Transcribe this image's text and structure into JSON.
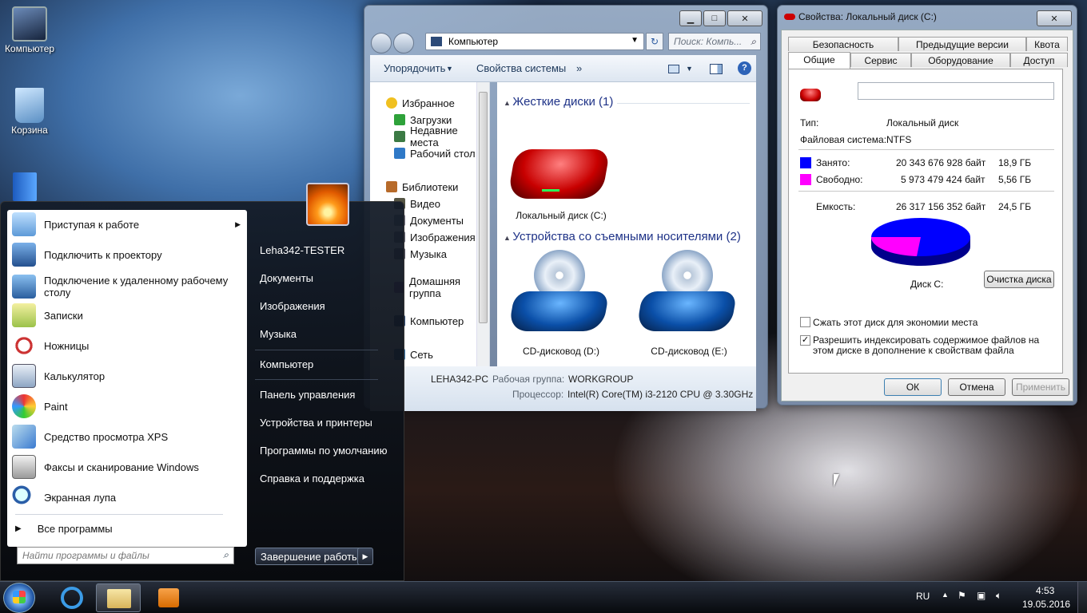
{
  "desktop": {
    "icons": [
      {
        "label": "Компьютер"
      },
      {
        "label": "Корзина"
      }
    ]
  },
  "explorer": {
    "breadcrumb": "Компьютер",
    "search_placeholder": "Поиск: Компь...",
    "toolbar": {
      "organize": "Упорядочить",
      "system_props": "Свойства системы",
      "more": "»"
    },
    "nav": {
      "favorites": "Избранное",
      "downloads": "Загрузки",
      "recent": "Недавние места",
      "desktop": "Рабочий стол",
      "libraries": "Библиотеки",
      "video": "Видео",
      "documents": "Документы",
      "images": "Изображения",
      "music": "Музыка",
      "homegroup": "Домашняя группа",
      "computer": "Компьютер",
      "network": "Сеть"
    },
    "groups": {
      "hdd": "Жесткие диски (1)",
      "removable": "Устройства со съемными носителями (2)"
    },
    "devices": {
      "c": "Локальный диск (C:)",
      "d": "CD-дисковод (D:)",
      "e": "CD-дисковод (E:)"
    },
    "details": {
      "pc_name": "LEHA342-PC",
      "workgroup_label": "Рабочая группа:",
      "workgroup": "WORKGROUP",
      "cpu_label": "Процессор:",
      "cpu": "Intel(R) Core(TM) i3-2120 CPU @ 3.30GHz"
    }
  },
  "start_menu": {
    "items": [
      "Приступая к работе",
      "Подключить к проектору",
      "Подключение к удаленному рабочему столу",
      "Записки",
      "Ножницы",
      "Калькулятор",
      "Paint",
      "Средство просмотра XPS",
      "Факсы и сканирование Windows",
      "Экранная лупа"
    ],
    "all_programs": "Все программы",
    "search_placeholder": "Найти программы и файлы",
    "right": [
      "Leha342-TESTER",
      "Документы",
      "Изображения",
      "Музыка",
      "Компьютер",
      "Панель управления",
      "Устройства и принтеры",
      "Программы по умолчанию",
      "Справка и поддержка"
    ],
    "shutdown": "Завершение работы"
  },
  "properties": {
    "title": "Свойства: Локальный диск (C:)",
    "tabs_row1": [
      "Безопасность",
      "Предыдущие версии",
      "Квота"
    ],
    "tabs_row2": [
      "Общие",
      "Сервис",
      "Оборудование",
      "Доступ"
    ],
    "type_label": "Тип:",
    "type_value": "Локальный диск",
    "fs_label": "Файловая система:",
    "fs_value": "NTFS",
    "used_label": "Занято:",
    "used_bytes": "20 343 676 928 байт",
    "used_gb": "18,9 ГБ",
    "free_label": "Свободно:",
    "free_bytes": "5 973 479 424 байт",
    "free_gb": "5,56 ГБ",
    "capacity_label": "Емкость:",
    "capacity_bytes": "26 317 156 352 байт",
    "capacity_gb": "24,5 ГБ",
    "disk_label": "Диск C:",
    "cleanup": "Очистка диска",
    "compress": "Сжать этот диск для экономии места",
    "index": "Разрешить индексировать содержимое файлов на этом диске в дополнение к свойствам файла",
    "ok": "ОК",
    "cancel": "Отмена",
    "apply": "Применить",
    "colors": {
      "used": "#0000ff",
      "free": "#ff00ff"
    }
  },
  "taskbar": {
    "lang": "RU",
    "time": "4:53",
    "date": "19.05.2016"
  }
}
